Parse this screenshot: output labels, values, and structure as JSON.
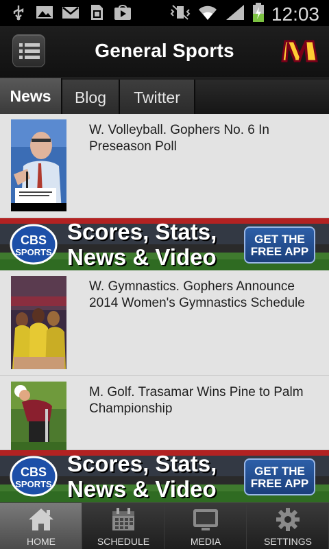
{
  "status_bar": {
    "time": "12:03",
    "icons_left": [
      "usb-icon",
      "image-icon",
      "gmail-icon",
      "sim-icon",
      "play-store-icon"
    ],
    "icons_right": [
      "vibrate-icon",
      "wifi-icon",
      "signal-icon",
      "battery-icon"
    ]
  },
  "header": {
    "title": "General Sports",
    "menu_icon": "list-icon",
    "logo": "minnesota-m-logo"
  },
  "tabs": [
    {
      "label": "News",
      "active": true
    },
    {
      "label": "Blog",
      "active": false
    },
    {
      "label": "Twitter",
      "active": false
    }
  ],
  "news": [
    {
      "headline": "W. Volleyball. Gophers No. 6 In Preseason Poll"
    },
    {
      "headline": "W. Gymnastics. Gophers Announce 2014 Women's Gymnastics Schedule"
    },
    {
      "headline": "M. Golf. Trasamar Wins Pine to Palm Championship"
    }
  ],
  "ad": {
    "brand_line1": "CBS",
    "brand_line2": "SPORTS",
    "line1": "Scores, Stats,",
    "line2": "News & Video",
    "cta_line1": "GET THE",
    "cta_line2": "FREE APP"
  },
  "bottom_nav": [
    {
      "label": "HOME",
      "icon": "home-icon",
      "active": true
    },
    {
      "label": "SCHEDULE",
      "icon": "calendar-icon",
      "active": false
    },
    {
      "label": "MEDIA",
      "icon": "monitor-icon",
      "active": false
    },
    {
      "label": "SETTINGS",
      "icon": "gear-icon",
      "active": false
    }
  ],
  "colors": {
    "background": "#e3e3e3",
    "header": "#151515",
    "ad_stripe": "#b22222",
    "cta_blue": "#2d5fa8",
    "logo_maroon": "#7a0019",
    "logo_gold": "#ffcc33"
  }
}
